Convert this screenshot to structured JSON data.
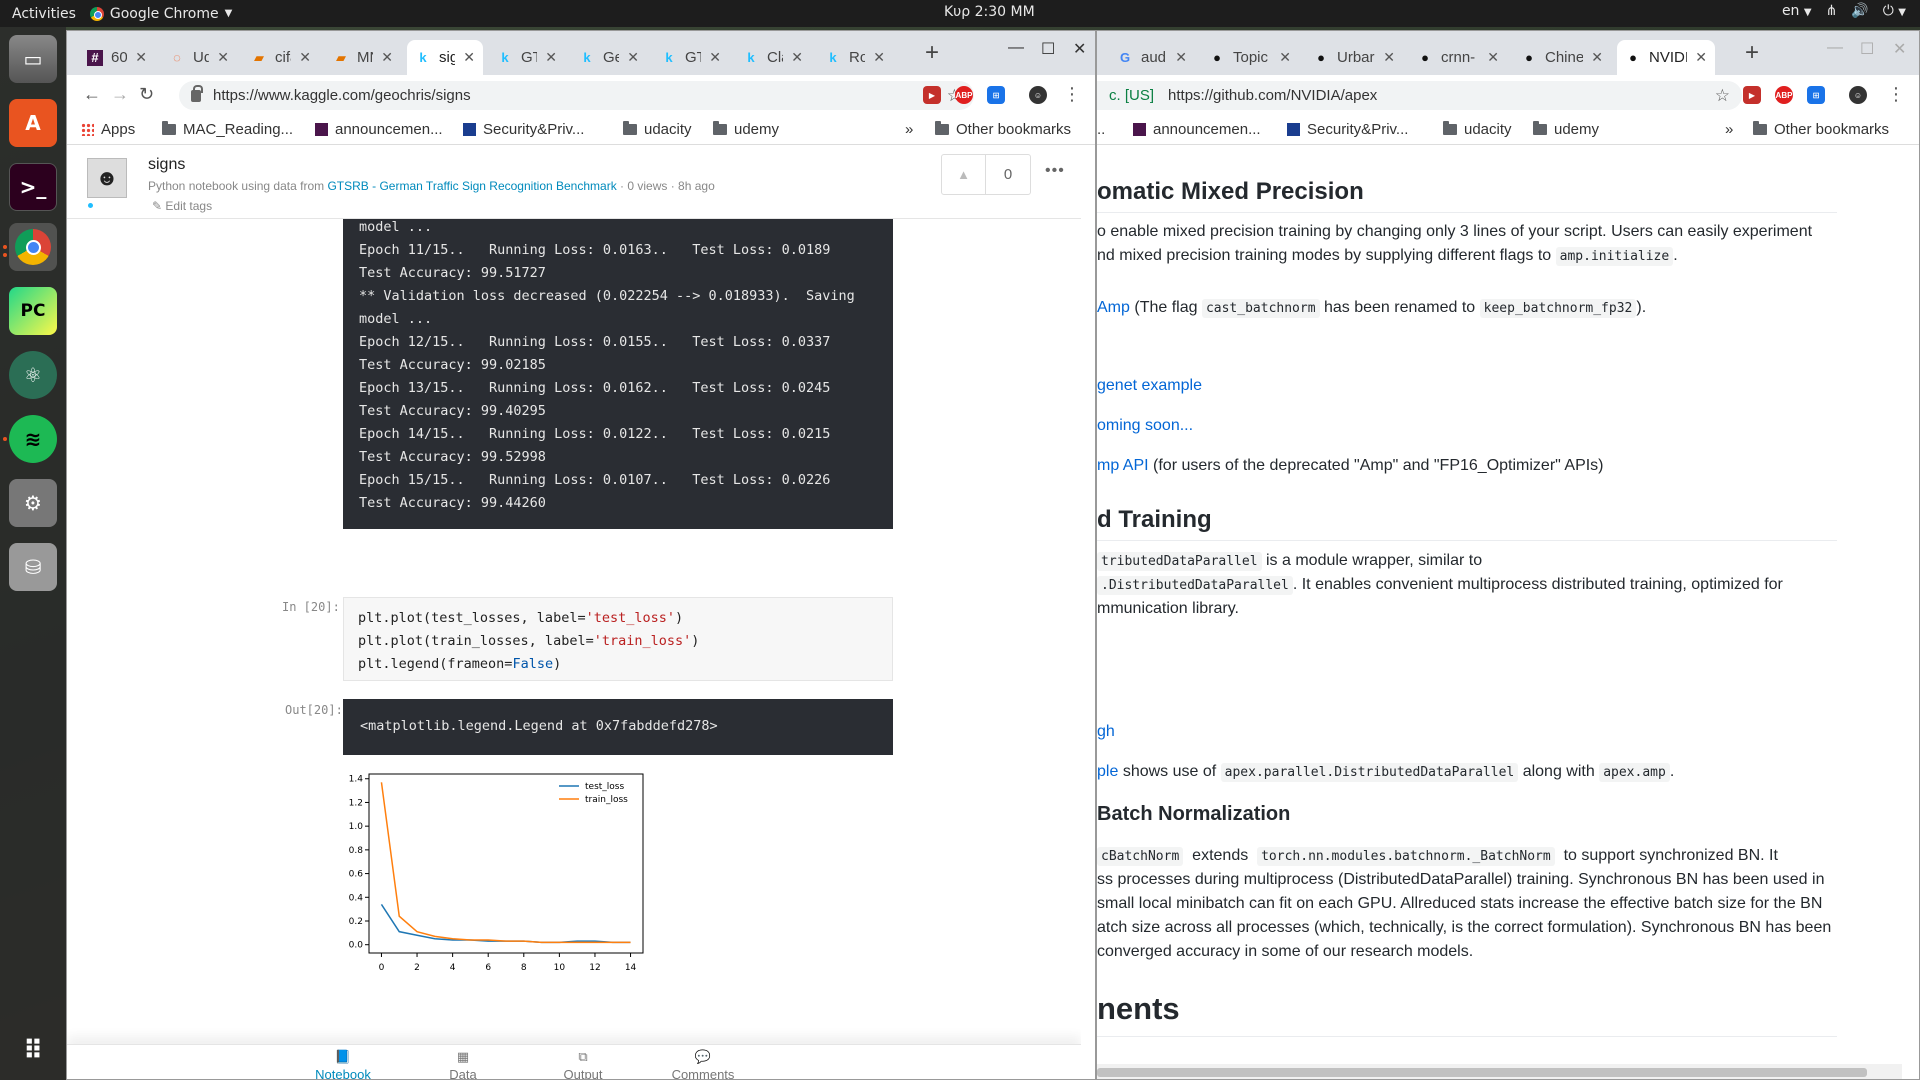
{
  "topbar": {
    "activities": "Activities",
    "app_name": "Google Chrome",
    "clock": "Κυρ  2:30 ΜΜ",
    "lang": "en"
  },
  "dock": {
    "items": [
      "files",
      "software-center",
      "terminal",
      "chrome",
      "pycharm",
      "atom",
      "spotify",
      "system-settings",
      "disks",
      "show-applications"
    ]
  },
  "kaggle_window": {
    "tabs": [
      "60",
      "Ud",
      "cifa",
      "MN",
      "sig",
      "GT",
      "Ge",
      "GT",
      "Cla",
      "Ro"
    ],
    "url": "https://www.kaggle.com/geochris/signs",
    "bookmarks": [
      "Apps",
      "MAC_Reading...",
      "announcemen...",
      "Security&Priv...",
      "udacity",
      "udemy",
      "Other bookmarks"
    ],
    "notebook": {
      "title": "signs",
      "subtitle_prefix": "Python notebook using data from",
      "dataset_link": "GTSRB - German Traffic Sign Recognition Benchmark",
      "subtitle_suffix": "· 0 views · 8h ago",
      "edit_tags": "Edit tags",
      "votes": "0"
    },
    "output_lines": [
      "model ...",
      "Epoch 11/15..   Running Loss: 0.0163..   Test Loss: 0.0189",
      "Test Accuracy: 99.51727",
      "** Validation loss decreased (0.022254 --> 0.018933).  Saving",
      "model ...",
      "Epoch 12/15..   Running Loss: 0.0155..   Test Loss: 0.0337",
      "Test Accuracy: 99.02185",
      "Epoch 13/15..   Running Loss: 0.0162..   Test Loss: 0.0245",
      "Test Accuracy: 99.40295",
      "Epoch 14/15..   Running Loss: 0.0122..   Test Loss: 0.0215",
      "Test Accuracy: 99.52998",
      "Epoch 15/15..   Running Loss: 0.0107..   Test Loss: 0.0226",
      "Test Accuracy: 99.44260"
    ],
    "in_prompt": "In [20]:",
    "out_prompt": "Out[20]:",
    "code": {
      "l1a": "plt.plot(test_losses, label=",
      "l1s": "'test_loss'",
      "l1b": ")",
      "l2a": "plt.plot(train_losses, label=",
      "l2s": "'train_loss'",
      "l2b": ")",
      "l3a": "plt.legend(frameon=",
      "l3k": "False",
      "l3b": ")"
    },
    "out_text": "<matplotlib.legend.Legend at 0x7fabddefd278>",
    "bottom_nav": [
      "Notebook",
      "Data",
      "Output",
      "Comments"
    ]
  },
  "chart_data": {
    "type": "line",
    "x": [
      0,
      1,
      2,
      3,
      4,
      5,
      6,
      7,
      8,
      9,
      10,
      11,
      12,
      13,
      14
    ],
    "series": [
      {
        "name": "test_loss",
        "color": "#1f77b4",
        "values": [
          0.34,
          0.11,
          0.08,
          0.05,
          0.04,
          0.04,
          0.03,
          0.03,
          0.03,
          0.02,
          0.02,
          0.03,
          0.03,
          0.02,
          0.02
        ]
      },
      {
        "name": "train_loss",
        "color": "#ff7f0e",
        "values": [
          1.37,
          0.24,
          0.11,
          0.07,
          0.05,
          0.04,
          0.04,
          0.03,
          0.03,
          0.02,
          0.02,
          0.02,
          0.02,
          0.02,
          0.02
        ]
      }
    ],
    "xticks": [
      "0",
      "2",
      "4",
      "6",
      "8",
      "10",
      "12",
      "14"
    ],
    "yticks": [
      "0.0",
      "0.2",
      "0.4",
      "0.6",
      "0.8",
      "1.0",
      "1.2",
      "1.4"
    ],
    "xlim": [
      -0.7,
      14.7
    ],
    "ylim": [
      -0.07,
      1.44
    ],
    "legend": "top-right"
  },
  "github_window": {
    "tabs": [
      "audio",
      "Topic",
      "Urbar",
      "crnn-",
      "Chine",
      "NVIDI"
    ],
    "url_prefix": "c. [US]",
    "url": "https://github.com/NVIDIA/apex",
    "bookmarks": [
      "announcemen...",
      "Security&Priv...",
      "udacity",
      "udemy",
      "Other bookmarks"
    ],
    "content": {
      "h_amp": "omatic Mixed Precision",
      "p1a": "o enable mixed precision training by changing only 3 lines of your script. Users can easily experiment",
      "p1b": "nd mixed precision training modes by supplying different flags to",
      "p1b_code": "amp.initialize",
      "p2_link": "Amp",
      "p2a": "(The flag",
      "p2_code1": "cast_batchnorm",
      "p2b": "has been renamed to",
      "p2_code2": "keep_batchnorm_fp32",
      "p2c": ").",
      "link_imagenet": "genet example",
      "link_coming": "oming soon...",
      "link_api": "mp API",
      "api_text": "(for users of the deprecated \"Amp\" and \"FP16_Optimizer\" APIs)",
      "h_dist": "d Training",
      "p3a_code": "tributedDataParallel",
      "p3a": "is a module wrapper, similar to",
      "p3b_code": ".DistributedDataParallel",
      "p3b": ". It enables convenient multiprocess distributed training, optimized for",
      "p3c": "mmunication library.",
      "link_gh": "gh",
      "link_ple": "ple",
      "p4a": "shows use of",
      "p4_code1": "apex.parallel.DistributedDataParallel",
      "p4b": "along with",
      "p4_code2": "apex.amp",
      "p4c": ".",
      "h_bn": "Batch Normalization",
      "p5_code1": "cBatchNorm",
      "p5a": "extends",
      "p5_code2": "torch.nn.modules.batchnorm._BatchNorm",
      "p5b": "to support synchronized BN. It",
      "p5c": "ss processes during multiprocess (DistributedDataParallel) training. Synchronous BN has been used in",
      "p5d": "small local minibatch can fit on each GPU. Allreduced stats increase the effective batch size for the BN",
      "p5e": "atch size across all processes (which, technically, is the correct formulation). Synchronous BN has been",
      "p5f": "converged accuracy in some of our research models.",
      "h_ments": "nents"
    }
  }
}
